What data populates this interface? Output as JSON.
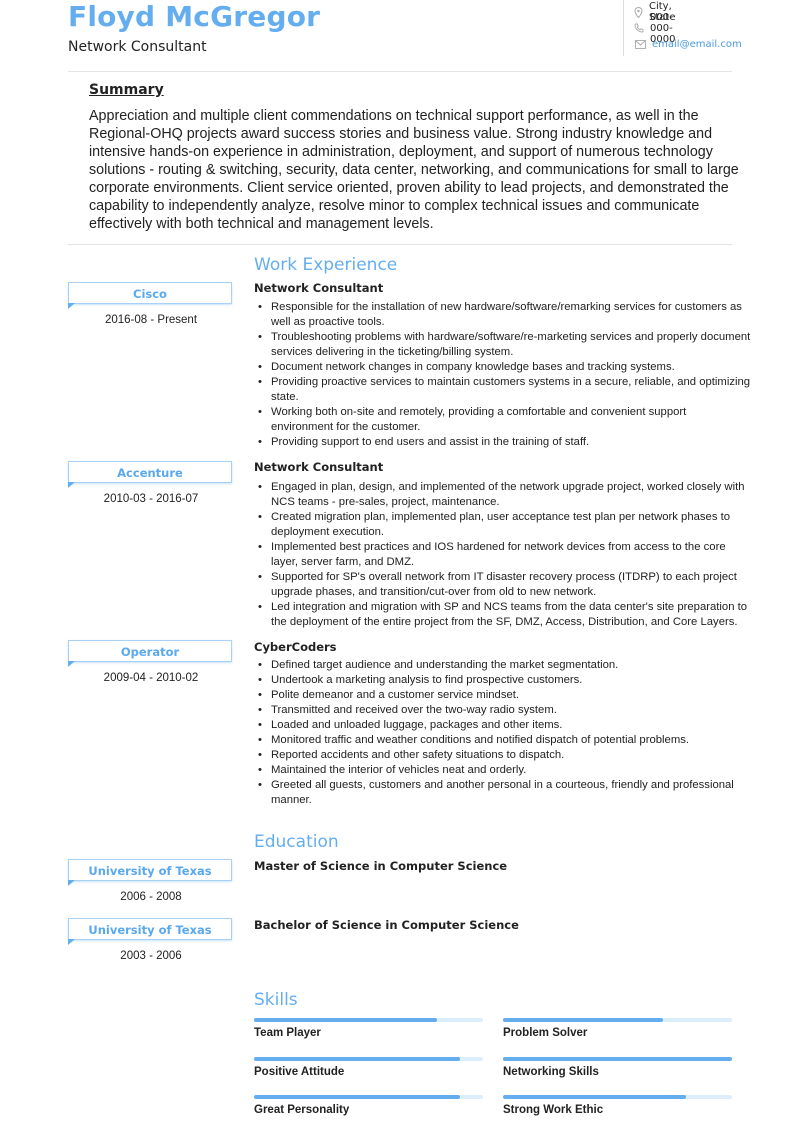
{
  "header": {
    "name": "Floyd McGregor",
    "title": "Network Consultant",
    "contact": {
      "location": "City, State",
      "phone": "000-000-0000",
      "email": "email@email.com"
    }
  },
  "summary": {
    "title": "Summary",
    "text": "Appreciation and multiple client commendations on technical support performance, as well in the Regional-OHQ projects award success stories and business value. Strong industry knowledge and intensive hands-on experience in administration, deployment, and support of numerous technology solutions - routing & switching, security, data center, networking, and communications for small to large corporate environments. Client service oriented, proven ability to lead projects, and demonstrated the capability to independently analyze, resolve minor to complex technical issues and communicate effectively with both technical and management levels."
  },
  "work": {
    "title": "Work Experience",
    "jobs": [
      {
        "company": "Cisco",
        "dates": "2016-08 - Present",
        "position": "Network Consultant",
        "bullets": [
          "Responsible for the installation of new hardware/software/remarking services for customers as well as proactive tools.",
          "Troubleshooting problems with hardware/software/re-marketing services and properly document services delivering in the ticketing/billing system.",
          "Document network changes in company knowledge bases and tracking systems.",
          "Providing proactive services to maintain customers systems in a secure, reliable, and optimizing state.",
          "Working both on-site and remotely, providing a comfortable and convenient support environment for the customer.",
          "Providing support to end users and assist in the training of staff."
        ]
      },
      {
        "company": "Accenture",
        "dates": "2010-03 - 2016-07",
        "position": "Network Consultant",
        "bullets": [
          "Engaged in plan, design, and implemented of the network upgrade project, worked closely with NCS teams - pre-sales, project, maintenance.",
          "Created migration plan, implemented plan, user acceptance test plan per network phases to deployment execution.",
          "Implemented best practices and IOS hardened for network devices from access to the core layer, server farm, and DMZ.",
          "Supported for SP's overall network from IT disaster recovery process (ITDRP) to each project upgrade phases, and transition/cut-over from old to new network.",
          "Led integration and migration with SP and NCS teams from the data center's site preparation to the deployment of the entire project from the SF, DMZ, Access, Distribution, and Core Layers."
        ]
      },
      {
        "company": "Operator",
        "dates": "2009-04 - 2010-02",
        "position": "CyberCoders",
        "bullets": [
          "Defined target audience and understanding the market segmentation.",
          "Undertook a marketing analysis to find prospective customers.",
          "Polite demeanor and a customer service mindset.",
          "Transmitted and received over the two-way radio system.",
          "Loaded and unloaded luggage, packages and other items.",
          "Monitored traffic and weather conditions and notified dispatch of potential problems.",
          "Reported accidents and other safety situations to dispatch.",
          "Maintained the interior of vehicles neat and orderly.",
          "Greeted all guests, customers and another personal in a courteous, friendly and professional manner."
        ]
      }
    ]
  },
  "education": {
    "title": "Education",
    "entries": [
      {
        "school": "University of Texas",
        "dates": "2006 - 2008",
        "degree": "Master of Science in Computer Science"
      },
      {
        "school": "University of Texas",
        "dates": "2003 - 2006",
        "degree": "Bachelor of Science in Computer Science"
      }
    ]
  },
  "skills": {
    "title": "Skills",
    "items": [
      {
        "name": "Team Player",
        "level": 0.8
      },
      {
        "name": "Problem Solver",
        "level": 0.7
      },
      {
        "name": "Positive Attitude",
        "level": 0.9
      },
      {
        "name": "Networking Skills",
        "level": 1.0
      },
      {
        "name": "Great Personality",
        "level": 0.9
      },
      {
        "name": "Strong Work Ethic",
        "level": 0.8
      }
    ]
  },
  "colors": {
    "accent": "#64aef0",
    "accent_light": "#dcedfc",
    "text": "#222222"
  }
}
